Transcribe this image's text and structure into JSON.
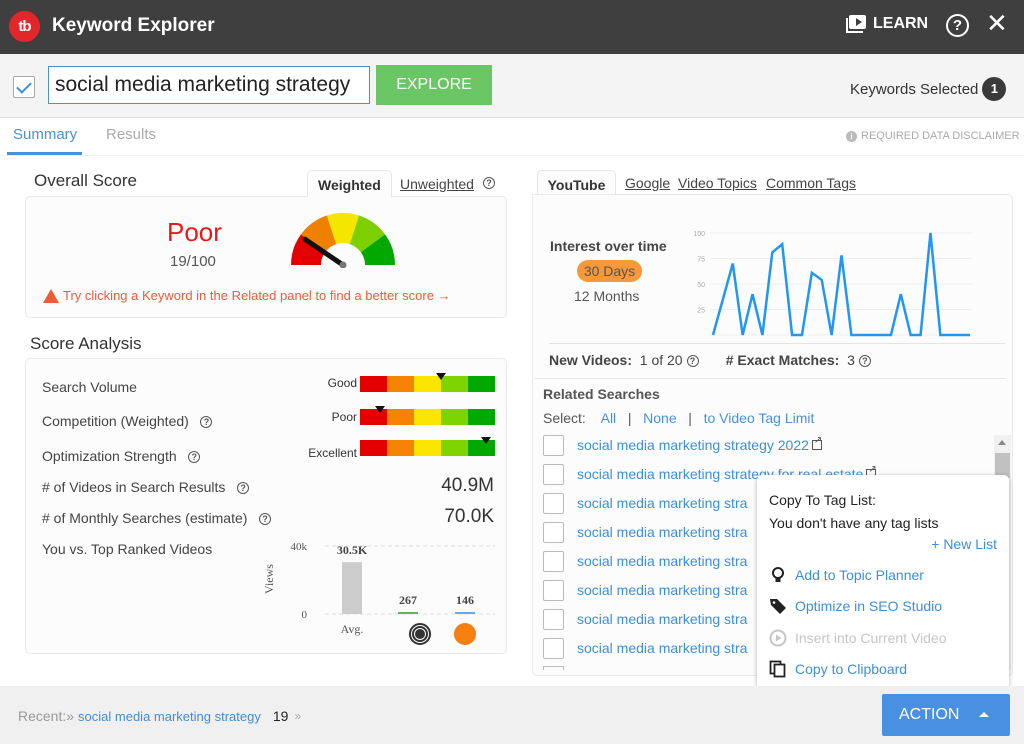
{
  "app": {
    "title": "Keyword Explorer",
    "logo_text": "tb",
    "learn_label": "LEARN",
    "help_symbol": "?",
    "close_symbol": "✕"
  },
  "search": {
    "checked": true,
    "value": "social media marketing strategy",
    "explore_label": "EXPLORE",
    "keywords_selected_label": "Keywords Selected",
    "keywords_selected_count": "1"
  },
  "tabs": {
    "summary": "Summary",
    "results": "Results",
    "active": "Summary",
    "disclaimer": "REQUIRED DATA DISCLAIMER",
    "info_symbol": "i"
  },
  "overall": {
    "title": "Overall Score",
    "tab_weighted": "Weighted",
    "tab_unweighted": "Unweighted",
    "active_tab": "Weighted",
    "rating": "Poor",
    "score": "19/100",
    "score_value": 19,
    "hint": "Try clicking a Keyword in the Related panel to find a better score →",
    "gauge_colors": [
      "#e50000",
      "#f08000",
      "#f5e600",
      "#7cd000",
      "#00a800"
    ]
  },
  "analysis": {
    "title": "Score Analysis",
    "rows": [
      {
        "label": "Search Volume",
        "rating": "Good",
        "position": 0.6,
        "help": false
      },
      {
        "label": "Competition (Weighted)",
        "rating": "Poor",
        "position": 0.15,
        "help": true
      },
      {
        "label": "Optimization Strength",
        "rating": "Excellent",
        "position": 0.93,
        "help": true
      }
    ],
    "videos_label": "# of Videos in Search Results",
    "videos_value": "40.9M",
    "monthly_label": "# of Monthly Searches (estimate)",
    "monthly_value": "70.0K",
    "vs_label": "You vs. Top Ranked Videos",
    "scale_colors": [
      "#e50000",
      "#f58200",
      "#fae600",
      "#7ed400",
      "#00a800"
    ]
  },
  "chart_data": [
    {
      "type": "bar",
      "title": "You vs. Top Ranked Videos",
      "ylabel": "Views",
      "yticks": [
        "0",
        "40k"
      ],
      "ylim": [
        0,
        40000
      ],
      "categories": [
        "Avg.",
        "target-icon",
        "channel-avatar"
      ],
      "values": [
        30500,
        267,
        146
      ],
      "data_labels": [
        "30.5K",
        "267",
        "146"
      ],
      "colors": [
        "#cccccc",
        "#5cb85c",
        "#6fa8dc"
      ]
    },
    {
      "type": "line",
      "title": "Interest over time",
      "yticks": [
        "25",
        "50",
        "75",
        "100"
      ],
      "ylim": [
        0,
        100
      ],
      "range": "30 Days",
      "color": "#2196f3",
      "values": [
        0,
        35,
        70,
        0,
        40,
        0,
        81,
        89,
        0,
        0,
        61,
        54,
        0,
        78,
        0,
        0,
        0,
        0,
        0,
        40,
        0,
        0,
        100,
        0,
        0,
        0,
        0
      ]
    }
  ],
  "related": {
    "tabs": [
      "YouTube",
      "Google",
      "Video Topics",
      "Common Tags"
    ],
    "active_tab": "YouTube",
    "interest_title": "Interest over time",
    "range_options": [
      "30 Days",
      "12 Months"
    ],
    "selected_range": "30 Days",
    "new_videos_label": "New Videos:",
    "new_videos_value": "1 of 20",
    "exact_label": "# Exact Matches:",
    "exact_value": "3",
    "searches_title": "Related Searches",
    "select_label": "Select:",
    "select_all": "All",
    "select_none": "None",
    "select_limit": "to Video Tag Limit",
    "sep": "|",
    "items": [
      "social media marketing strategy 2022",
      "social media marketing strategy for real estate",
      "social media marketing stra",
      "social media marketing stra",
      "social media marketing stra",
      "social media marketing stra",
      "social media marketing stra",
      "social media marketing stra"
    ]
  },
  "popup": {
    "title": "Copy To Tag List:",
    "subtitle": "You don't have any tag lists",
    "new_list": "+ New List",
    "items": [
      {
        "label": "Add to Topic Planner",
        "icon": "lightbulb-icon",
        "disabled": false
      },
      {
        "label": "Optimize in SEO Studio",
        "icon": "tag-icon",
        "disabled": false
      },
      {
        "label": "Insert into Current Video",
        "icon": "play-circle-icon",
        "disabled": true
      },
      {
        "label": "Copy to Clipboard",
        "icon": "copy-icon",
        "disabled": false
      }
    ]
  },
  "footer": {
    "recent_label": "Recent:»",
    "recent_item": "social media marketing strategy",
    "recent_count": "19",
    "more": "»",
    "action_label": "ACTION"
  }
}
